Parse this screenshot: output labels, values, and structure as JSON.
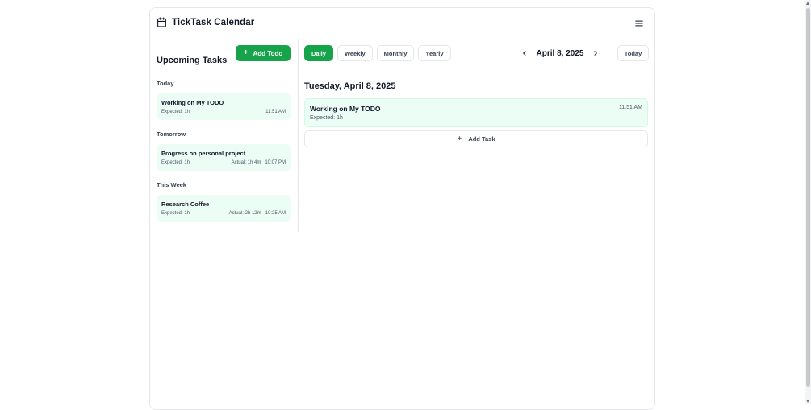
{
  "app": {
    "title": "TickTask Calendar"
  },
  "sidebar": {
    "title": "Upcoming Tasks",
    "add_todo_label": "Add Todo",
    "groups": [
      {
        "label": "Today",
        "tasks": [
          {
            "name": "Working on My TODO",
            "expected": "Expected: 1h",
            "actual": "",
            "time": "11:51 AM"
          }
        ]
      },
      {
        "label": "Tomorrow",
        "tasks": [
          {
            "name": "Progress on personal project",
            "expected": "Expected: 1h",
            "actual": "Actual: 1h 4m",
            "time": "10:07 PM"
          }
        ]
      },
      {
        "label": "This Week",
        "tasks": [
          {
            "name": "Research Coffee",
            "expected": "Expected: 1h",
            "actual": "Actual: 2h 12m",
            "time": "10:25 AM"
          }
        ]
      }
    ]
  },
  "views": {
    "daily": "Daily",
    "weekly": "Weekly",
    "monthly": "Monthly",
    "yearly": "Yearly",
    "active": "Daily"
  },
  "nav": {
    "current_date": "April 8, 2025",
    "today_label": "Today"
  },
  "day": {
    "heading": "Tuesday, April 8, 2025",
    "events": [
      {
        "name": "Working on My TODO",
        "expected": "Expected: 1h",
        "time": "11:51 AM"
      }
    ],
    "add_task_label": "Add Task"
  },
  "colors": {
    "accent": "#16a34a",
    "card_bg": "#ecfdf5",
    "border": "#e5e7eb"
  }
}
